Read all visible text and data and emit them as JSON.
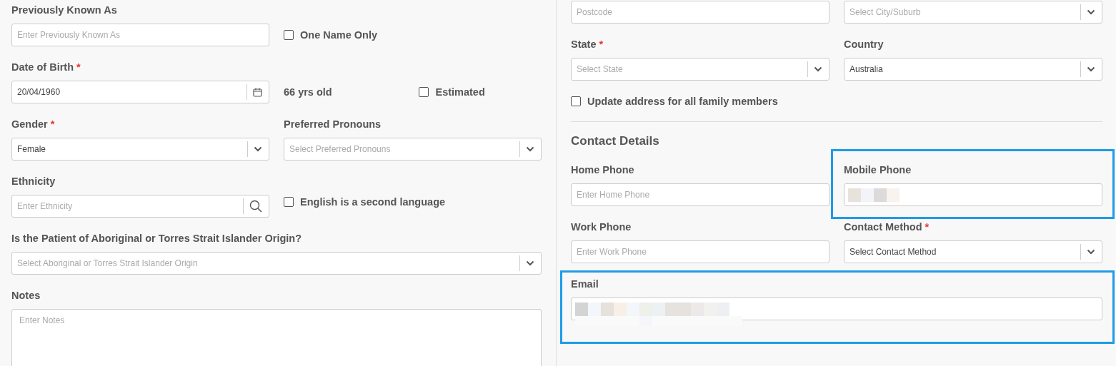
{
  "left_column": {
    "rows": [
      {
        "items": [
          {
            "kind": "text",
            "label": "Previously Known As",
            "placeholder": "Enter Previously Known As"
          },
          {
            "kind": "checkbox",
            "label": "One Name Only",
            "checked": false
          }
        ]
      },
      {
        "items": [
          {
            "kind": "date",
            "label": "Date of Birth",
            "required_mark": "*",
            "value": "20/04/1960"
          },
          {
            "kind": "note",
            "text": "66 yrs old"
          },
          {
            "kind": "checkbox",
            "label": "Estimated",
            "checked": false
          }
        ]
      },
      {
        "items": [
          {
            "kind": "select",
            "label": "Gender",
            "required_mark": "*",
            "value": "Female"
          },
          {
            "kind": "select",
            "label": "Preferred Pronouns",
            "placeholder": "Select Preferred Pronouns"
          }
        ]
      },
      {
        "items": [
          {
            "kind": "search",
            "label": "Ethnicity",
            "placeholder": "Enter Ethnicity"
          },
          {
            "kind": "checkbox",
            "label": "English is a second language",
            "checked": false
          }
        ]
      },
      {
        "full": true,
        "items": [
          {
            "kind": "select",
            "label": "Is the Patient of Aboriginal or Torres Strait Islander Origin?",
            "placeholder": "Select Aboriginal or Torres Strait Islander Origin"
          }
        ]
      },
      {
        "full": true,
        "items": [
          {
            "kind": "textarea",
            "label": "Notes",
            "placeholder": "Enter Notes"
          }
        ]
      }
    ]
  },
  "right_column": {
    "rows": [
      {
        "items": [
          {
            "kind": "text",
            "placeholder": "Postcode"
          },
          {
            "kind": "select",
            "placeholder": "Select City/Suburb"
          }
        ]
      },
      {
        "items": [
          {
            "kind": "select",
            "label": "State",
            "required_mark": "*",
            "placeholder": "Select State"
          },
          {
            "kind": "select",
            "label": "Country",
            "value": "Australia"
          }
        ]
      },
      {
        "full": true,
        "items": [
          {
            "kind": "checkbox",
            "label": "Update address for all family members",
            "checked": false
          }
        ]
      },
      {
        "full": true,
        "items": [
          {
            "kind": "heading",
            "text": "Contact Details"
          }
        ]
      },
      {
        "items": [
          {
            "kind": "text",
            "label": "Home Phone",
            "placeholder": "Enter Home Phone"
          },
          {
            "kind": "text",
            "label": "Mobile Phone",
            "redacted": true,
            "highlighted": true
          }
        ]
      },
      {
        "items": [
          {
            "kind": "text",
            "label": "Work Phone",
            "placeholder": "Enter Work Phone"
          },
          {
            "kind": "select",
            "label": "Contact Method",
            "required_mark": "*",
            "value": "Select Contact Method"
          }
        ]
      },
      {
        "full": true,
        "items": [
          {
            "kind": "text",
            "label": "Email",
            "redacted": true,
            "highlighted": true
          }
        ]
      }
    ]
  }
}
